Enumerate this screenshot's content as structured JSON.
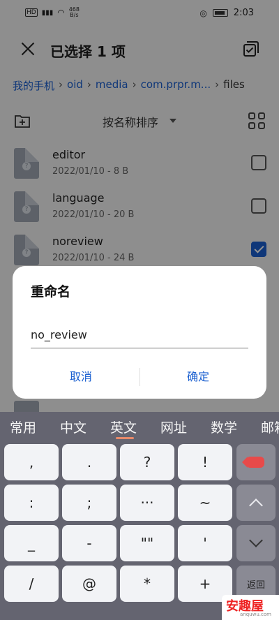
{
  "status": {
    "network_speed": "468",
    "network_unit": "B/s",
    "time": "2:03"
  },
  "header": {
    "title": "已选择 1 项"
  },
  "breadcrumb": [
    "我的手机",
    "oid",
    "media",
    "com.prpr.m...",
    "files"
  ],
  "sort": {
    "label": "按名称排序"
  },
  "files": [
    {
      "name": "editor",
      "meta": "2022/01/10 - 8 B",
      "checked": false
    },
    {
      "name": "language",
      "meta": "2022/01/10 - 20 B",
      "checked": false
    },
    {
      "name": "noreview",
      "meta": "2022/01/10 - 24 B",
      "checked": true
    }
  ],
  "dialog": {
    "title": "重命名",
    "input_value": "no_review",
    "cancel_label": "取消",
    "ok_label": "确定"
  },
  "keyboard": {
    "tabs": [
      "常用",
      "中文",
      "英文",
      "网址",
      "数学",
      "邮箱"
    ],
    "active_tab": "英文",
    "rows": [
      [
        ",",
        ".",
        "?",
        "!"
      ],
      [
        ":",
        ";",
        "···",
        "~"
      ],
      [
        "_",
        "-",
        "\"\"",
        "'"
      ],
      [
        "/",
        "@",
        "*",
        "+"
      ]
    ],
    "return_label": "返回"
  },
  "colors": {
    "accent": "#1a5fd0",
    "keyboard_bg": "#646470",
    "backspace": "#e84a4a"
  },
  "watermark": {
    "text": "安趣屋",
    "sub": "anquwu.com"
  }
}
